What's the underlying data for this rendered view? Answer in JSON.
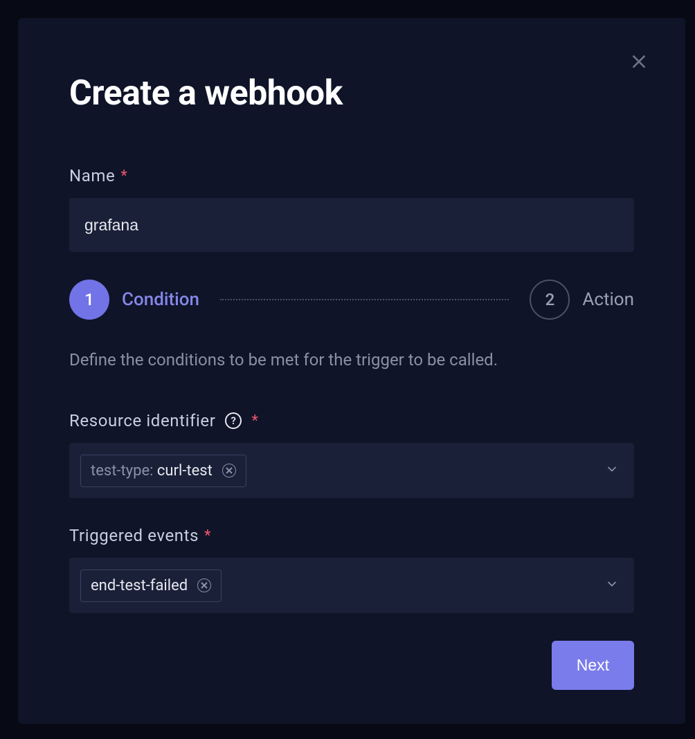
{
  "modal": {
    "title": "Create a webhook",
    "name_label": "Name",
    "name_value": "grafana",
    "stepper": {
      "step1_num": "1",
      "step1_label": "Condition",
      "step2_num": "2",
      "step2_label": "Action"
    },
    "description": "Define the conditions to be met for the trigger to be called.",
    "resource_label": "Resource identifier",
    "resource_tag_key": "test-type: ",
    "resource_tag_val": "curl-test",
    "events_label": "Triggered events",
    "events_tag": "end-test-failed",
    "next_label": "Next",
    "help_glyph": "?"
  }
}
